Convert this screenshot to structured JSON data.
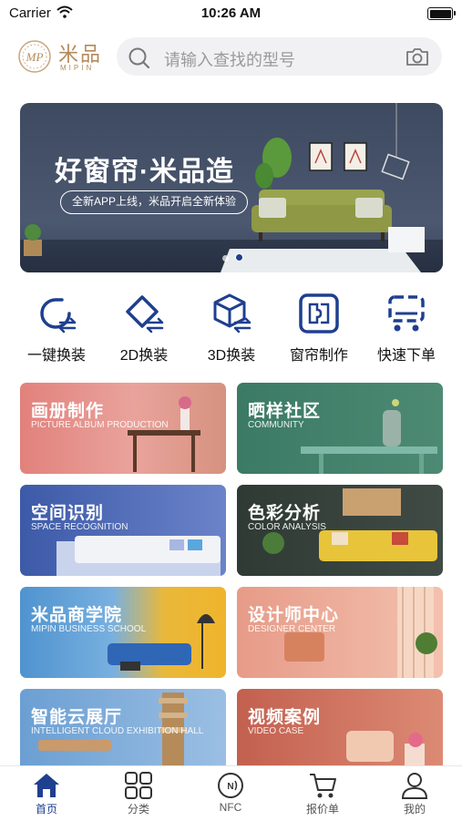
{
  "status_bar": {
    "carrier": "Carrier",
    "time": "10:26 AM"
  },
  "header": {
    "logo_name": "米品",
    "logo_sub": "MIPIN",
    "search_placeholder": "请输入查找的型号"
  },
  "banner": {
    "title": "好窗帘·米品造",
    "tagline": "全新APP上线，米品开启全新体验",
    "page_count": 2,
    "active_page": 2
  },
  "quick_actions": [
    {
      "label": "一键换装",
      "icon": "rotate-swap-icon"
    },
    {
      "label": "2D换装",
      "icon": "diamond-swap-icon"
    },
    {
      "label": "3D换装",
      "icon": "cube-swap-icon"
    },
    {
      "label": "窗帘制作",
      "icon": "curtain-puzzle-icon"
    },
    {
      "label": "快速下单",
      "icon": "quick-order-cart-icon"
    }
  ],
  "cards": [
    {
      "title": "画册制作",
      "subtitle": "PICTURE ALBUM PRODUCTION",
      "color": "#e58a84"
    },
    {
      "title": "晒样社区",
      "subtitle": "COMMUNITY",
      "color": "#3f7e6a"
    },
    {
      "title": "空间识别",
      "subtitle": "SPACE RECOGNITION",
      "color": "#4c67b3"
    },
    {
      "title": "色彩分析",
      "subtitle": "COLOR ANALYSIS",
      "color": "#37423e"
    },
    {
      "title": "米品商学院",
      "subtitle": "MIPIN BUSINESS SCHOOL",
      "color": "#5a9bd0"
    },
    {
      "title": "设计师中心",
      "subtitle": "DESIGNER CENTER",
      "color": "#e89a86"
    },
    {
      "title": "智能云展厅",
      "subtitle": "INTELLIGENT CLOUD EXHIBITION HALL",
      "color": "#6fa2d6"
    },
    {
      "title": "视频案例",
      "subtitle": "VIDEO CASE",
      "color": "#c46a5a"
    }
  ],
  "tabs": [
    {
      "label": "首页",
      "icon": "home-icon",
      "active": true
    },
    {
      "label": "分类",
      "icon": "grid-icon",
      "active": false
    },
    {
      "label": "NFC",
      "icon": "nfc-icon",
      "active": false
    },
    {
      "label": "报价单",
      "icon": "cart-icon",
      "active": false
    },
    {
      "label": "我的",
      "icon": "profile-icon",
      "active": false
    }
  ],
  "colors": {
    "accent": "#1f3f8f",
    "brand": "#b48a5b",
    "banner_bg": "#445169"
  }
}
